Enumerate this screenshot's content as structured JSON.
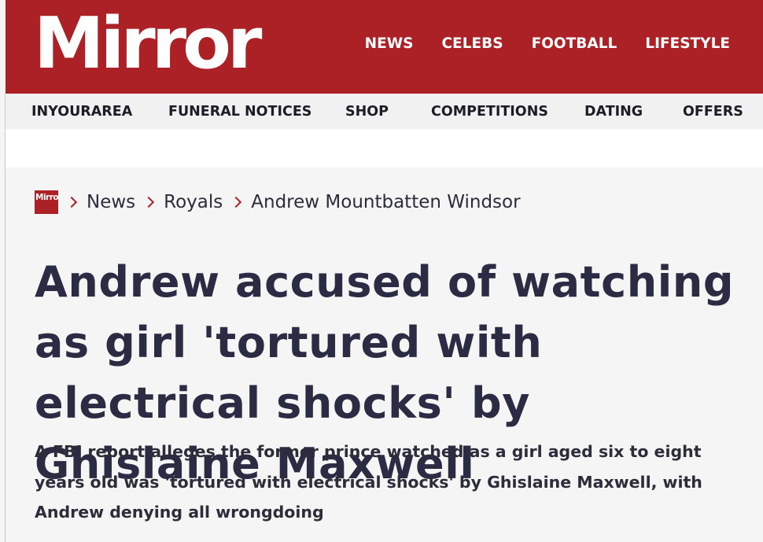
{
  "header": {
    "logo_text": "Mirror",
    "nav": [
      "NEWS",
      "CELEBS",
      "FOOTBALL",
      "LIFESTYLE"
    ]
  },
  "subnav": [
    "INYOURAREA",
    "FUNERAL NOTICES",
    "SHOP",
    "COMPETITIONS",
    "DATING",
    "OFFERS"
  ],
  "breadcrumb": {
    "logo_text": "Mirror",
    "items": [
      "News",
      "Royals",
      "Andrew Mountbatten Windsor"
    ]
  },
  "article": {
    "headline": "Andrew accused of watching as girl 'tortured with electrical shocks' by Ghislaine Maxwell",
    "standfirst": "A FBI report alleges the former prince watched as a girl aged six to eight years old was 'tortured with electrical shocks' by Ghislaine Maxwell, with Andrew denying all wrongdoing"
  },
  "colors": {
    "brand_red": "#ab2126",
    "headline_text": "#2c2b44",
    "body_text": "#2c2c3a"
  }
}
